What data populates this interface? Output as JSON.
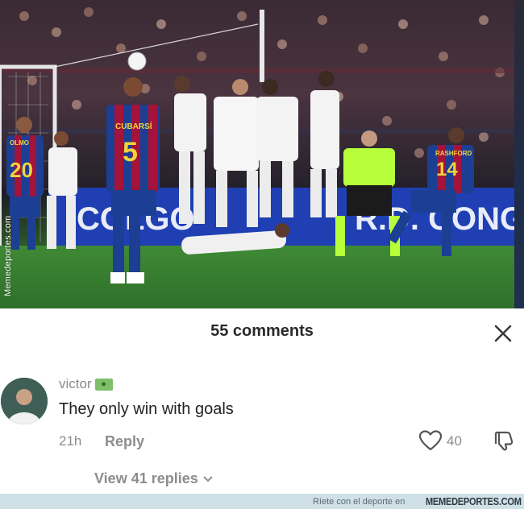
{
  "photo": {
    "watermark": "Memedeportes.com",
    "ad_board_left": "COLGO",
    "ad_board_right": "R.D. CONG",
    "jersey_5_name": "CUBARSÍ",
    "jersey_5_number": "5",
    "jersey_14_name": "RASHFORD",
    "jersey_14_number": "14",
    "jersey_20_name": "OLMO",
    "jersey_20_number": "20"
  },
  "comments": {
    "title": "55 comments",
    "close_icon": "close-icon",
    "items": [
      {
        "username": "victor",
        "badge": "🇧🇷",
        "text": "They only win with goals",
        "time": "21h",
        "reply_label": "Reply",
        "likes": "40",
        "view_replies_label": "View 41 replies"
      }
    ]
  },
  "footer": {
    "tagline": "Ríete con el deporte en",
    "brand": "MEMEDEPORTES.COM"
  },
  "colors": {
    "barca_blue": "#1c3f94",
    "barca_red": "#a3133a",
    "referee": "#b7ff3b",
    "footer_bg": "#cfe0e6"
  }
}
